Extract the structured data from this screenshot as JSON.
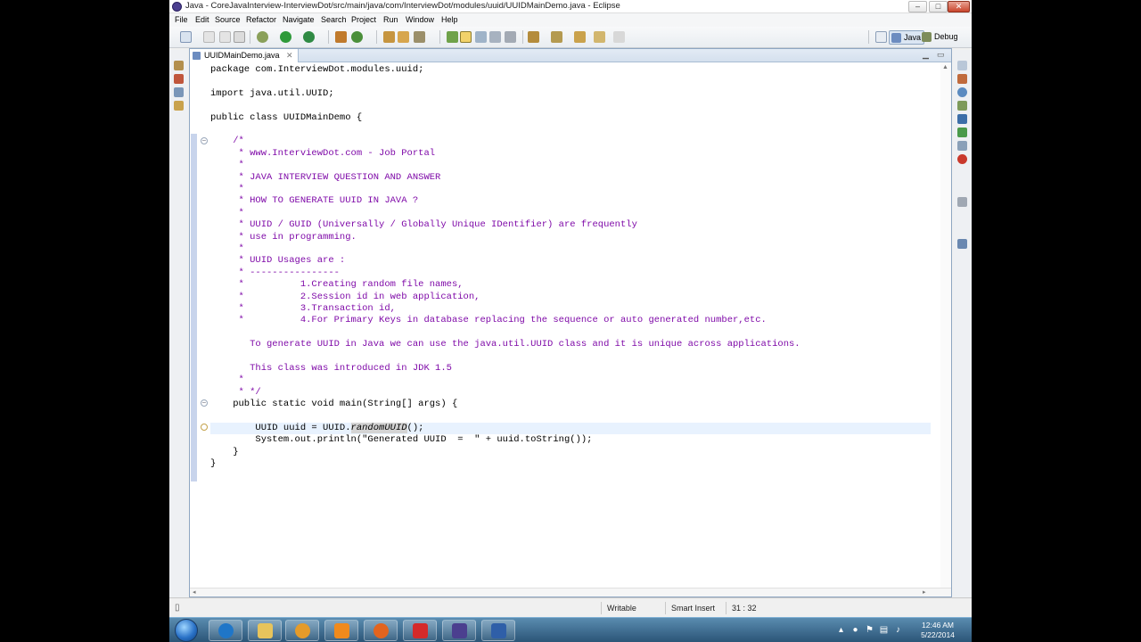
{
  "window": {
    "title": "Java - CoreJavaInterview-InterviewDot/src/main/java/com/InterviewDot/modules/uuid/UUIDMainDemo.java - Eclipse",
    "minimize": "–",
    "maximize": "□",
    "close": "✕"
  },
  "menu": [
    "File",
    "Edit",
    "Source",
    "Refactor",
    "Navigate",
    "Search",
    "Project",
    "Run",
    "Window",
    "Help"
  ],
  "perspectives": {
    "java": "Java",
    "debug": "Debug"
  },
  "editor": {
    "tab_label": "UUIDMainDemo.java",
    "tab_close": "✕",
    "current_line": 31,
    "code_lines": [
      [
        {
          "t": "package com.InterviewDot.modules.uuid;"
        }
      ],
      [],
      [
        {
          "t": "import java.util.UUID;"
        }
      ],
      [],
      [
        {
          "t": "public class UUIDMainDemo {"
        }
      ],
      [],
      [
        {
          "t": "    "
        },
        {
          "t": "/*",
          "c": "cmt"
        }
      ],
      [
        {
          "t": "     * www.InterviewDot.com - Job Portal",
          "c": "cmt"
        }
      ],
      [
        {
          "t": "     *",
          "c": "cmt"
        }
      ],
      [
        {
          "t": "     * JAVA INTERVIEW QUESTION AND ANSWER",
          "c": "cmt"
        }
      ],
      [
        {
          "t": "     *",
          "c": "cmt"
        }
      ],
      [
        {
          "t": "     * HOW TO GENERATE UUID IN JAVA ?",
          "c": "cmt"
        }
      ],
      [
        {
          "t": "     *",
          "c": "cmt"
        }
      ],
      [
        {
          "t": "     * UUID / GUID (Universally / Globally Unique IDentifier) are frequently",
          "c": "cmt"
        }
      ],
      [
        {
          "t": "     * use in programming.",
          "c": "cmt"
        }
      ],
      [
        {
          "t": "     *",
          "c": "cmt"
        }
      ],
      [
        {
          "t": "     * UUID Usages are :",
          "c": "cmt"
        }
      ],
      [
        {
          "t": "     * ----------------",
          "c": "cmt"
        }
      ],
      [
        {
          "t": "     *          1.Creating random file names,",
          "c": "cmt"
        }
      ],
      [
        {
          "t": "     *          2.Session id in web application,",
          "c": "cmt"
        }
      ],
      [
        {
          "t": "     *          3.Transaction id,",
          "c": "cmt"
        }
      ],
      [
        {
          "t": "     *          4.For Primary Keys in database replacing the sequence or auto generated number,etc.",
          "c": "cmt"
        }
      ],
      [],
      [
        {
          "t": "       To generate UUID in Java we can use the java.util.UUID class and it is unique across applications.",
          "c": "cmt"
        }
      ],
      [],
      [
        {
          "t": "       This class was introduced in JDK 1.5",
          "c": "cmt"
        }
      ],
      [
        {
          "t": "     *",
          "c": "cmt"
        }
      ],
      [
        {
          "t": "     * */",
          "c": "cmt"
        }
      ],
      [
        {
          "t": "    public static void main(String[] args) {"
        }
      ],
      [],
      [
        {
          "t": "        UUID uuid = UUID."
        },
        {
          "t": "randomUUID",
          "c": "occ"
        },
        {
          "t": "();"
        }
      ],
      [
        {
          "t": "        System.out.println(\"Generated UUID  =  \" + uuid.toString());"
        }
      ],
      [
        {
          "t": "    }"
        }
      ],
      [
        {
          "t": "}"
        }
      ]
    ]
  },
  "status": {
    "writable": "Writable",
    "insert_mode": "Smart Insert",
    "position": "31 : 32"
  },
  "clock": {
    "time": "12:46 AM",
    "date": "5/22/2014"
  }
}
